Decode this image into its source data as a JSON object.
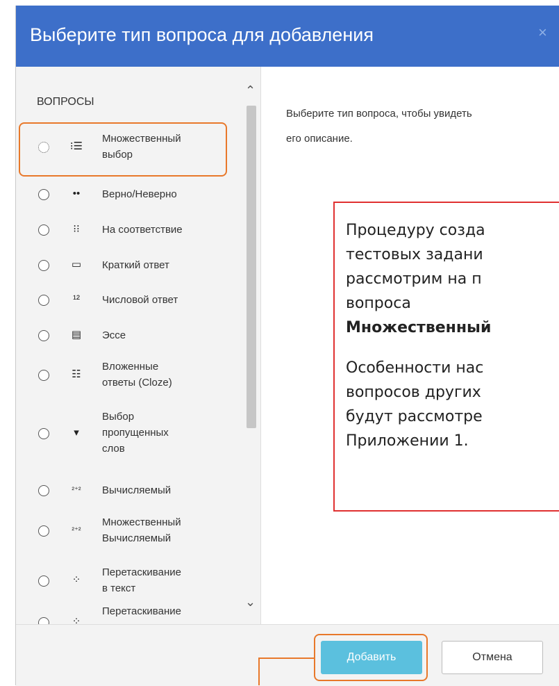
{
  "dialog": {
    "title": "Выберите тип вопроса для добавления",
    "close_glyph": "×",
    "header_color": "#3d6fc9"
  },
  "left": {
    "section_title": "ВОПРОСЫ",
    "options": [
      {
        "label_line1": "Множественный",
        "label_line2": "выбор",
        "icon": "multichoice-icon",
        "glyph": "⁝☰"
      },
      {
        "label_line1": "Верно/Неверно",
        "label_line2": "",
        "icon": "truefalse-icon",
        "glyph": "••"
      },
      {
        "label_line1": "На соответствие",
        "label_line2": "",
        "icon": "matching-icon",
        "glyph": "⁝⁝"
      },
      {
        "label_line1": "Краткий ответ",
        "label_line2": "",
        "icon": "shortanswer-icon",
        "glyph": "▭"
      },
      {
        "label_line1": "Числовой ответ",
        "label_line2": "",
        "icon": "numerical-icon",
        "glyph": "¹²"
      },
      {
        "label_line1": "Эссе",
        "label_line2": "",
        "icon": "essay-icon",
        "glyph": "▤"
      },
      {
        "label_line1": "Вложенные",
        "label_line2": "ответы (Cloze)",
        "icon": "cloze-icon",
        "glyph": "☷"
      },
      {
        "label_line1": "Выбор",
        "label_line2": "пропущенных",
        "label_line3": "слов",
        "icon": "gapselect-icon",
        "glyph": "▾"
      },
      {
        "label_line1": "Вычисляемый",
        "label_line2": "",
        "icon": "calculated-icon",
        "glyph": "²⁺²"
      },
      {
        "label_line1": "Множественный",
        "label_line2": "Вычисляемый",
        "icon": "calculatedmulti-icon",
        "glyph": "²⁺²"
      },
      {
        "label_line1": "Перетаскивание",
        "label_line2": "в текст",
        "icon": "ddwtos-icon",
        "glyph": "⁘"
      },
      {
        "label_line1": "Перетаскивание",
        "label_line2": "",
        "icon": "ddimage-icon",
        "glyph": "⁘"
      }
    ]
  },
  "right": {
    "description_line1": "Выберите тип вопроса, чтобы увидеть",
    "description_line2": "его описание."
  },
  "callout": {
    "lines": [
      "Процедуру созда",
      "тестовых задани",
      "рассмотрим на п",
      "вопроса",
      "Множественный",
      "Особенности нас",
      "вопросов других",
      "будут рассмотре",
      "Приложении 1."
    ]
  },
  "footer": {
    "add_label": "Добавить",
    "cancel_label": "Отмена"
  }
}
